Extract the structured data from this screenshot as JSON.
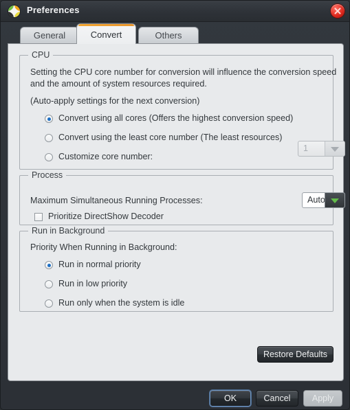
{
  "window": {
    "title": "Preferences",
    "icon": "app-logo-icon",
    "close_icon": "close-icon"
  },
  "tabs": [
    {
      "label": "General",
      "active": false
    },
    {
      "label": "Convert",
      "active": true
    },
    {
      "label": "Others",
      "active": false
    }
  ],
  "accent_colors": {
    "active_tab_underline": "#f0a32e",
    "radio_dot": "#1d6fc4",
    "combo_arrow_enabled": "#63bb4a",
    "combo_arrow_disabled": "#a7acb1",
    "close_button": "#e02b20",
    "ok_focus_ring": "#6f93bd"
  },
  "cpu": {
    "legend": "CPU",
    "description_line1": "Setting the CPU core number for conversion will influence the conversion speed",
    "description_line2": "and the amount of system resources required.",
    "note": "(Auto-apply settings for the next conversion)",
    "options": [
      {
        "label": "Convert using all cores (Offers the highest conversion speed)",
        "selected": true
      },
      {
        "label": "Convert using the least core number (The least resources)",
        "selected": false
      },
      {
        "label": "Customize core number:",
        "selected": false
      }
    ],
    "core_number_value": "1",
    "core_number_enabled": false
  },
  "process": {
    "legend": "Process",
    "max_processes_label": "Maximum Simultaneous Running Processes:",
    "max_processes_value": "Auto",
    "prioritize_checkbox_label": "Prioritize DirectShow Decoder",
    "prioritize_checked": false
  },
  "background": {
    "legend": "Run in Background",
    "priority_label": "Priority When Running in Background:",
    "options": [
      {
        "label": "Run in normal priority",
        "selected": true
      },
      {
        "label": "Run in low priority",
        "selected": false
      },
      {
        "label": "Run only when the system is idle",
        "selected": false
      }
    ]
  },
  "buttons": {
    "restore_defaults": "Restore Defaults",
    "ok": "OK",
    "cancel": "Cancel",
    "apply": "Apply",
    "apply_enabled": false
  }
}
